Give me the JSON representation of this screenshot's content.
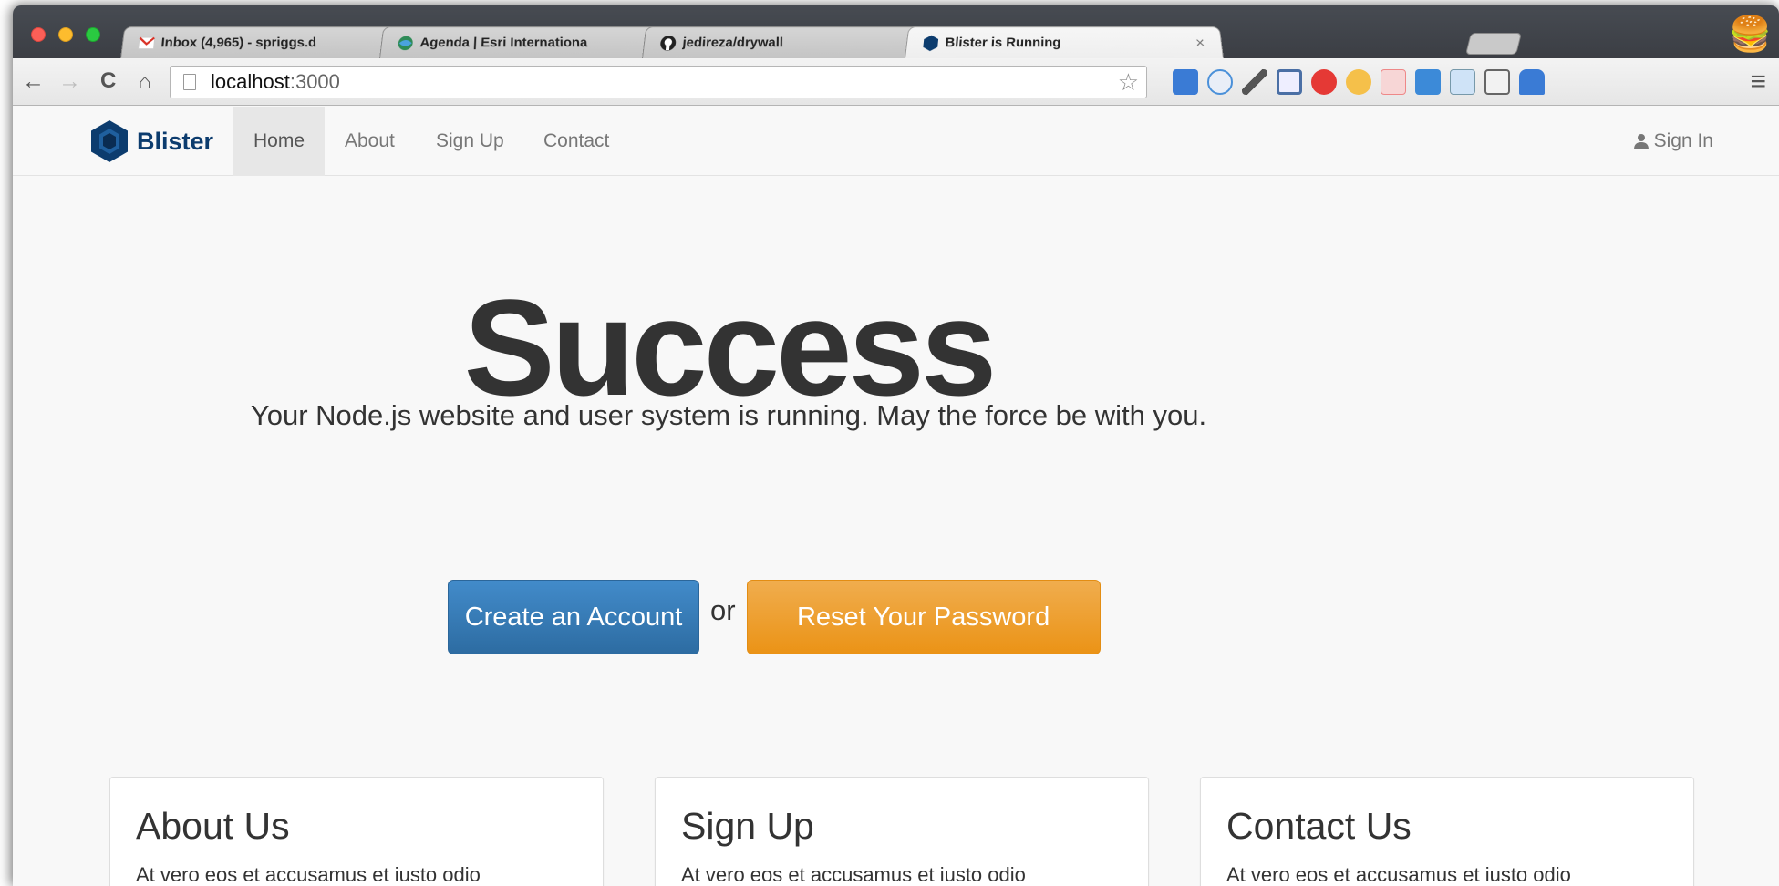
{
  "browser": {
    "tabs": [
      {
        "title": "Inbox (4,965) - spriggs.d",
        "favicon": "gmail-icon"
      },
      {
        "title": "Agenda | Esri Internationa",
        "favicon": "esri-icon"
      },
      {
        "title": "jedireza/drywall",
        "favicon": "github-icon"
      },
      {
        "title": "Blister is Running",
        "favicon": "blister-icon",
        "active": true
      }
    ],
    "url_host": "localhost",
    "url_port": ":3000"
  },
  "navbar": {
    "brand": "Blister",
    "items": [
      "Home",
      "About",
      "Sign Up",
      "Contact"
    ],
    "active_item": "Home",
    "signin": "Sign In"
  },
  "hero": {
    "title": "Success",
    "subtitle": "Your Node.js website and user system is running. May the force be with you.",
    "primary_button": "Create an Account",
    "or_text": "or",
    "secondary_button": "Reset Your Password"
  },
  "panels": [
    {
      "title": "About Us",
      "text": "At vero eos et accusamus et iusto odio"
    },
    {
      "title": "Sign Up",
      "text": "At vero eos et accusamus et iusto odio"
    },
    {
      "title": "Contact Us",
      "text": "At vero eos et accusamus et iusto odio"
    }
  ],
  "colors": {
    "primary": "#428bca",
    "warning": "#f0ad4e",
    "brand": "#0c3c6e"
  }
}
